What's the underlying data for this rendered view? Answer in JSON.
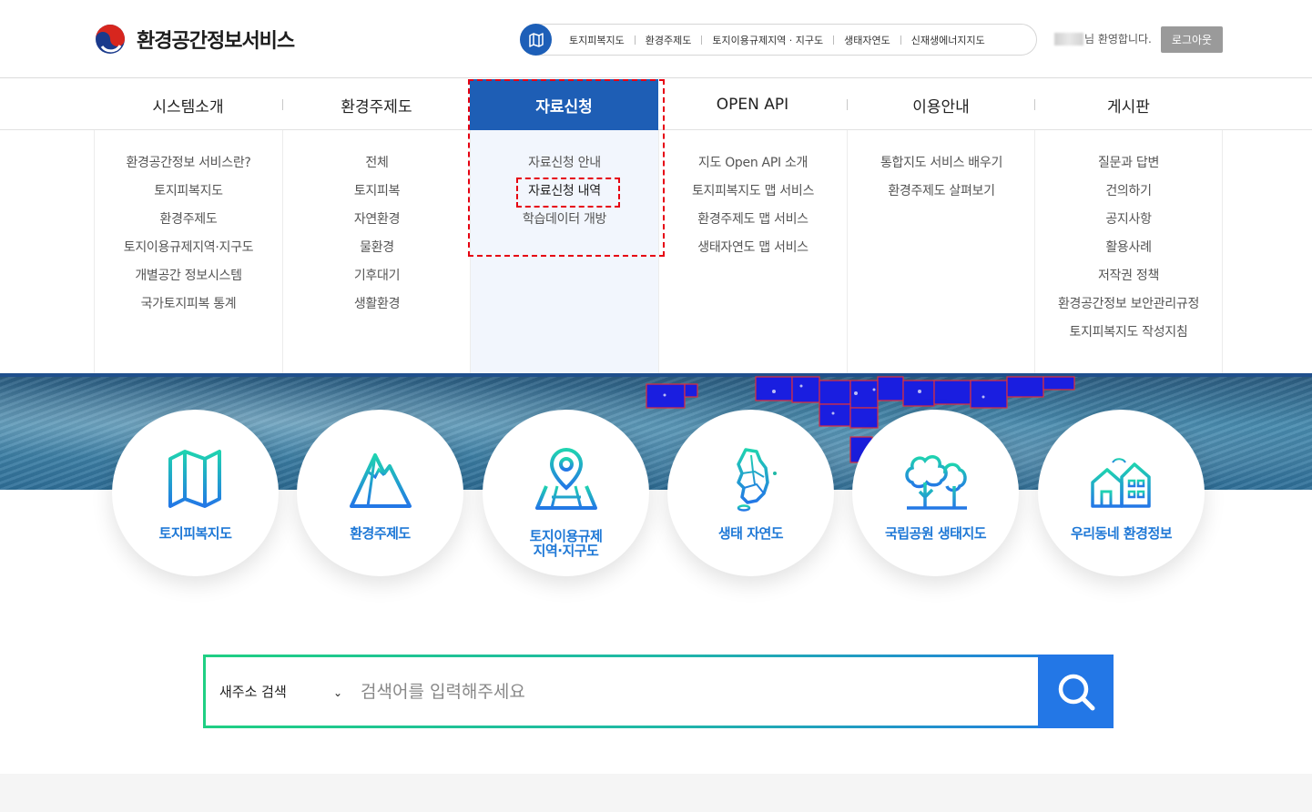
{
  "header": {
    "logo_text": "환경공간정보서비스",
    "quick_links": [
      "토지피복지도",
      "환경주제도",
      "토지이용규제지역 · 지구도",
      "생태자연도",
      "신재생에너지지도"
    ],
    "welcome_text": "님 환영합니다.",
    "logout_label": "로그아웃"
  },
  "gnb": {
    "items": [
      "시스템소개",
      "환경주제도",
      "자료신청",
      "OPEN API",
      "이용안내",
      "게시판"
    ],
    "active_index": 2
  },
  "submenu": {
    "col0": [
      "환경공간정보 서비스란?",
      "토지피복지도",
      "환경주제도",
      "토지이용규제지역·지구도",
      "개별공간 정보시스템",
      "국가토지피복 통계"
    ],
    "col1": [
      "전체",
      "토지피복",
      "자연환경",
      "물환경",
      "기후대기",
      "생활환경"
    ],
    "col2": [
      "자료신청 안내",
      "자료신청 내역",
      "학습데이터 개방"
    ],
    "col3": [
      "지도 Open API 소개",
      "토지피복지도 맵 서비스",
      "환경주제도 맵 서비스",
      "생태자연도 맵 서비스"
    ],
    "col4": [
      "통합지도 서비스 배우기",
      "환경주제도 살펴보기"
    ],
    "col5": [
      "질문과 답변",
      "건의하기",
      "공지사항",
      "활용사례",
      "저작권 정책",
      "환경공간정보 보안관리규정",
      "토지피복지도 작성지침"
    ]
  },
  "services": [
    {
      "label": "토지피복지도",
      "icon": "folded-map-icon"
    },
    {
      "label": "환경주제도",
      "icon": "mountain-icon"
    },
    {
      "label_line1": "토지이용규제",
      "label_line2": "지역·지구도",
      "icon": "map-pin-icon"
    },
    {
      "label": "생태 자연도",
      "icon": "korea-map-icon"
    },
    {
      "label": "국립공원 생태지도",
      "icon": "trees-icon"
    },
    {
      "label": "우리동네 환경정보",
      "icon": "houses-icon"
    }
  ],
  "search": {
    "select_value": "새주소 검색",
    "placeholder": "검색어를 입력해주세요"
  },
  "colors": {
    "primary": "#1e5eb5",
    "accent_text": "#1e78d6",
    "search_gradient_start": "#1fcf83",
    "search_gradient_end": "#2377e6",
    "highlight_dash": "#e60012"
  }
}
